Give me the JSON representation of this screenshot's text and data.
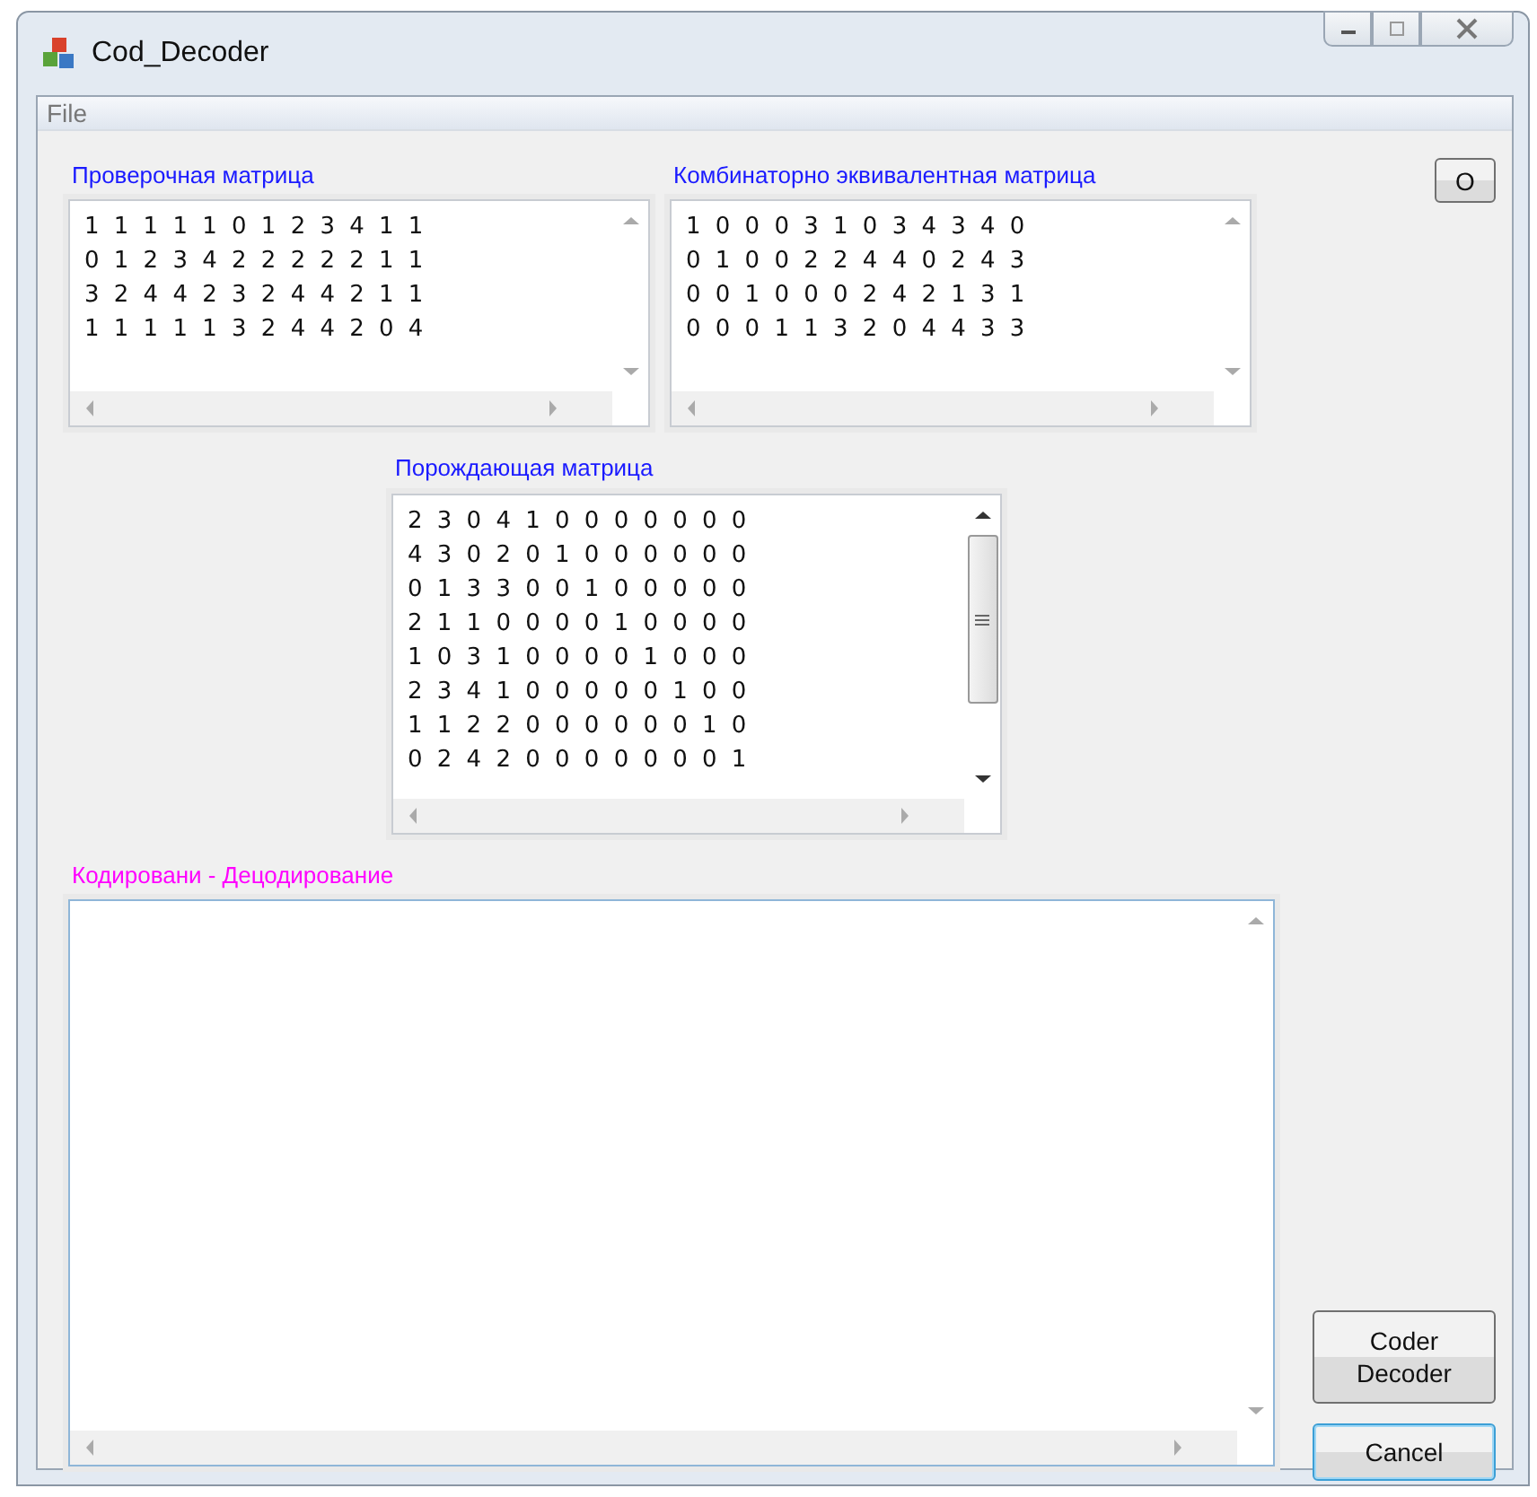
{
  "window": {
    "title": "Cod_Decoder"
  },
  "menu": [
    "File"
  ],
  "check_matrix": {
    "label": "Проверочная матрица",
    "rows": [
      "1 1 1 1 1 0 1 2 3 4 1 1",
      "0 1 2 3 4 2 2 2 2 2 1 1",
      "3 2 4 4 2 3 2 4 4 2 1 1",
      "1 1 1 1 1 3 2 4 4 2 0 4"
    ]
  },
  "equivalent_matrix": {
    "label": "Комбинаторно эквивалентная матрица",
    "rows": [
      "1 0 0 0 3 1 0 3 4 3 4 0",
      "0 1 0 0 2 2 4 4 0 2 4 3",
      "0 0 1 0 0 0 2 4 2 1 3 1",
      "0 0 0 1 1 3 2 0 4 4 3 3"
    ]
  },
  "o_button": "O",
  "generator_matrix": {
    "label": "Порождающая матрица",
    "rows": [
      "2 3 0 4 1 0 0 0 0 0 0 0",
      "4 3 0 2 0 1 0 0 0 0 0 0",
      "0 1 3 3 0 0 1 0 0 0 0 0",
      "2 1 1 0 0 0 0 1 0 0 0 0",
      "1 0 3 1 0 0 0 0 1 0 0 0",
      "2 3 4 1 0 0 0 0 0 1 0 0",
      "1 1 2 2 0 0 0 0 0 0 1 0",
      "0 2 4 2 0 0 0 0 0 0 0 1"
    ]
  },
  "coding": {
    "label": "Кодировани - Децодирование"
  },
  "buttons": [
    {
      "lines": [
        "Coder",
        "Decoder"
      ],
      "focused": false
    },
    {
      "lines": [
        "Cancel"
      ],
      "focused": true
    }
  ]
}
